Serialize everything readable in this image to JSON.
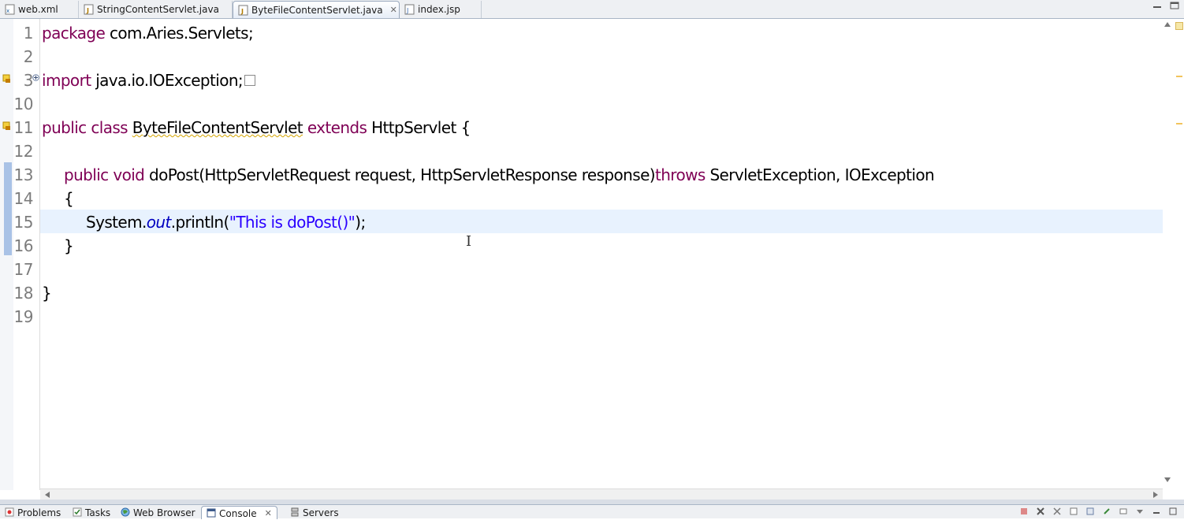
{
  "editor_tabs": [
    {
      "label": "web.xml",
      "icon": "xml-file-icon",
      "active": false
    },
    {
      "label": "StringContentServlet.java",
      "icon": "java-file-icon",
      "active": false
    },
    {
      "label": "ByteFileContentServlet.java",
      "icon": "java-file-icon",
      "active": true,
      "close": "✕"
    },
    {
      "label": "index.jsp",
      "icon": "jsp-file-icon",
      "active": false
    }
  ],
  "line_numbers": [
    "1",
    "2",
    "3",
    "10",
    "11",
    "12",
    "13",
    "14",
    "15",
    "16",
    "17",
    "18",
    "19"
  ],
  "code": {
    "l1_kw": "package",
    "l1_rest": " com.Aries.Servlets;",
    "l3_kw": "import",
    "l3_rest": " java.io.IOException;",
    "l11_kw1": "public",
    "l11_kw2": "class",
    "l11_name": "ByteFileContentServlet",
    "l11_kw3": "extends",
    "l11_rest": " HttpServlet {",
    "l13_kw1": "public",
    "l13_kw2": "void",
    "l13_mid": " doPost(HttpServletRequest request, HttpServletResponse response)",
    "l13_kw3": "throws",
    "l13_rest": " ServletException, IOException",
    "l14": "{",
    "l15_pre": "System.",
    "l15_field": "out",
    "l15_mid": ".println(",
    "l15_str": "\"This is doPost()\"",
    "l15_end": ");",
    "l16": "}",
    "l18": "}"
  },
  "bottom_tabs": [
    {
      "label": "Problems",
      "icon": "problems-icon"
    },
    {
      "label": "Tasks",
      "icon": "tasks-icon"
    },
    {
      "label": "Web Browser",
      "icon": "globe-icon"
    },
    {
      "label": "Console",
      "icon": "console-icon",
      "active": true,
      "close": "✕"
    },
    {
      "label": "Servers",
      "icon": "servers-icon"
    }
  ],
  "colors": {
    "keyword": "#7f0055",
    "string": "#2a00ff",
    "field": "#0000c0",
    "current_line": "#e8f2fe"
  }
}
